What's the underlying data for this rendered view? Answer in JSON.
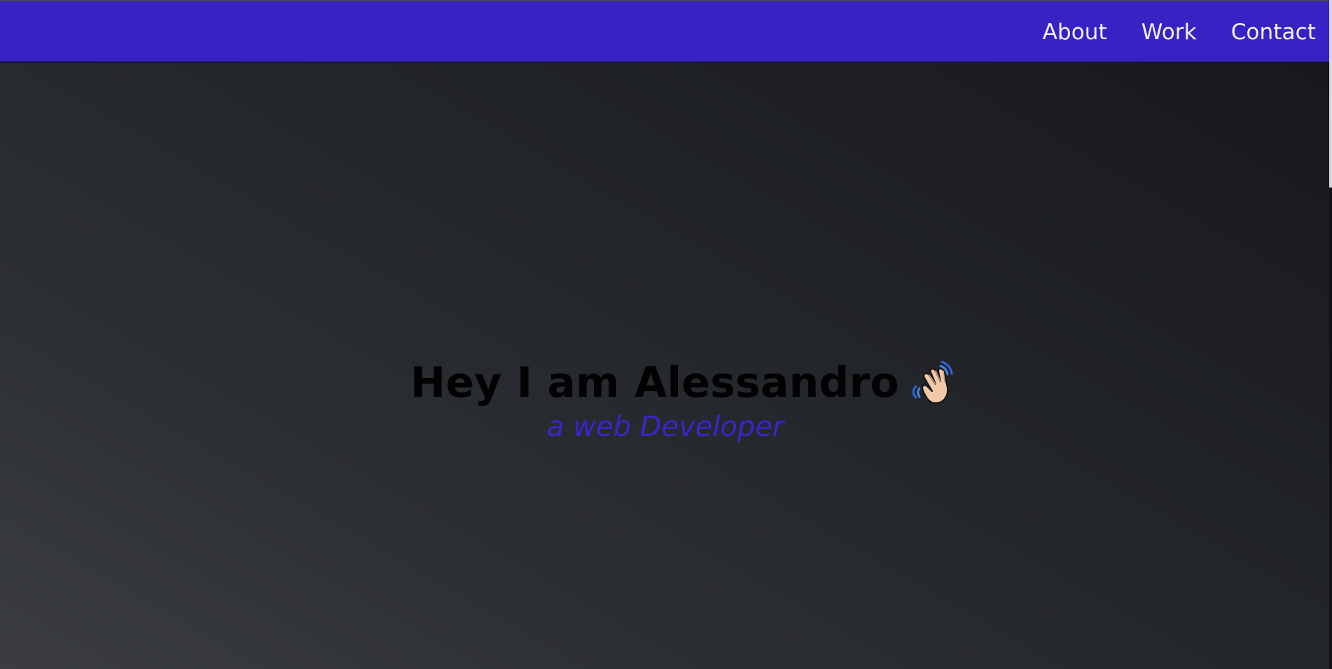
{
  "nav": {
    "links": [
      {
        "label": "About"
      },
      {
        "label": "Work"
      },
      {
        "label": "Contact"
      }
    ]
  },
  "hero": {
    "title": "Hey I am Alessandro",
    "subtitle": "a web Developer",
    "icon": "waving-hand-icon"
  },
  "colors": {
    "navbar": "#3822c4",
    "hero_dark": "#17181c",
    "hero_light": "#3b3d42",
    "title": "#020203",
    "subtitle": "#3a25c8",
    "nav_text": "#f2f2f8"
  }
}
